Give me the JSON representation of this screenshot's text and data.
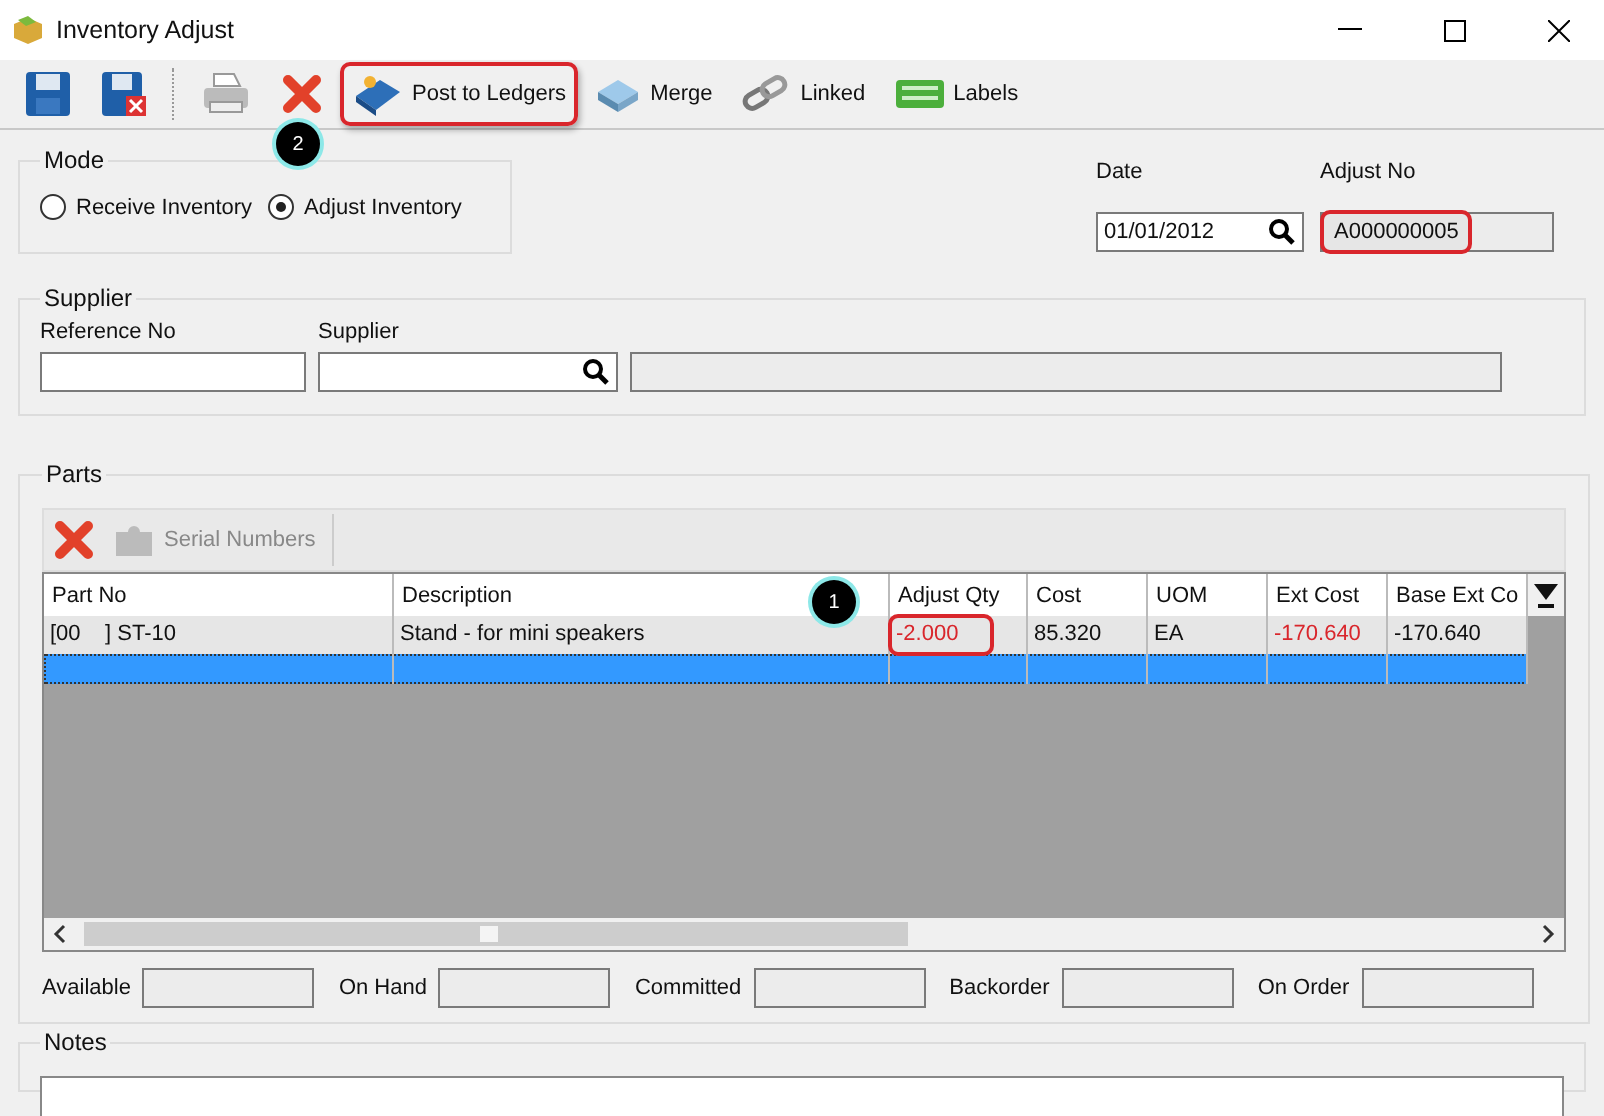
{
  "window": {
    "title": "Inventory Adjust"
  },
  "toolbar": [
    {
      "kind": "save",
      "highlighted": false
    },
    {
      "kind": "save-close",
      "highlighted": false
    },
    {
      "kind": "print",
      "highlighted": false
    },
    {
      "kind": "delete",
      "highlighted": false,
      "callout": "2"
    },
    {
      "kind": "post",
      "label": "Post to Ledgers",
      "highlighted": true
    },
    {
      "kind": "merge",
      "label": "Merge",
      "highlighted": false
    },
    {
      "kind": "link",
      "label": "Linked",
      "highlighted": false
    },
    {
      "kind": "labels",
      "label": "Labels",
      "highlighted": false
    }
  ],
  "mode": {
    "title": "Mode",
    "options": [
      {
        "label": "Receive Inventory",
        "selected": false
      },
      {
        "label": "Adjust Inventory",
        "selected": true
      }
    ]
  },
  "date": {
    "label": "Date",
    "value": "01/01/2012"
  },
  "adjust_no": {
    "label": "Adjust No",
    "value": "A000000005",
    "highlighted": true
  },
  "supplier": {
    "title": "Supplier",
    "reference_label": "Reference No",
    "supplier_label": "Supplier"
  },
  "parts": {
    "title": "Parts",
    "serial_numbers": "Serial Numbers",
    "columns": [
      "Part No",
      "Description",
      "Adjust Qty",
      "Cost",
      "UOM",
      "Ext Cost",
      "Base Ext Co"
    ],
    "callout": "1",
    "rows": [
      {
        "selected": false,
        "cells": [
          {
            "text": "[00    ] ST-10",
            "negative": false,
            "highlighted": false
          },
          {
            "text": "Stand - for mini speakers",
            "negative": false,
            "highlighted": false
          },
          {
            "text": "-2.000",
            "negative": true,
            "highlighted": true
          },
          {
            "text": "85.320",
            "negative": false,
            "highlighted": false
          },
          {
            "text": "EA",
            "negative": false,
            "highlighted": false
          },
          {
            "text": "-170.640",
            "negative": true,
            "highlighted": false
          },
          {
            "text": "-170.640",
            "negative": false,
            "highlighted": false
          }
        ]
      },
      {
        "selected": true,
        "cells": []
      }
    ],
    "stock": [
      "Available",
      "On Hand",
      "Committed",
      "Backorder",
      "On Order"
    ]
  },
  "notes": {
    "title": "Notes"
  }
}
